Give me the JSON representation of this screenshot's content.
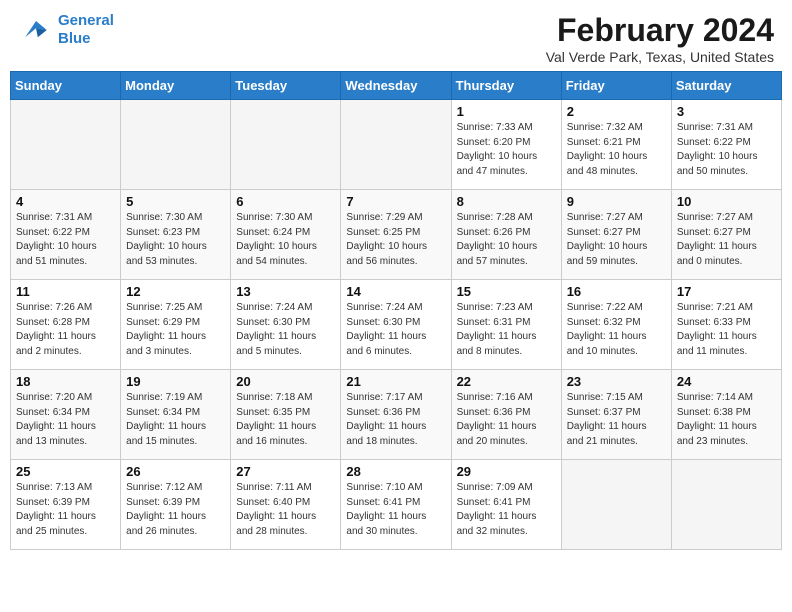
{
  "header": {
    "logo_line1": "General",
    "logo_line2": "Blue",
    "title": "February 2024",
    "subtitle": "Val Verde Park, Texas, United States"
  },
  "days_of_week": [
    "Sunday",
    "Monday",
    "Tuesday",
    "Wednesday",
    "Thursday",
    "Friday",
    "Saturday"
  ],
  "weeks": [
    [
      {
        "day": "",
        "info": ""
      },
      {
        "day": "",
        "info": ""
      },
      {
        "day": "",
        "info": ""
      },
      {
        "day": "",
        "info": ""
      },
      {
        "day": "1",
        "info": "Sunrise: 7:33 AM\nSunset: 6:20 PM\nDaylight: 10 hours\nand 47 minutes."
      },
      {
        "day": "2",
        "info": "Sunrise: 7:32 AM\nSunset: 6:21 PM\nDaylight: 10 hours\nand 48 minutes."
      },
      {
        "day": "3",
        "info": "Sunrise: 7:31 AM\nSunset: 6:22 PM\nDaylight: 10 hours\nand 50 minutes."
      }
    ],
    [
      {
        "day": "4",
        "info": "Sunrise: 7:31 AM\nSunset: 6:22 PM\nDaylight: 10 hours\nand 51 minutes."
      },
      {
        "day": "5",
        "info": "Sunrise: 7:30 AM\nSunset: 6:23 PM\nDaylight: 10 hours\nand 53 minutes."
      },
      {
        "day": "6",
        "info": "Sunrise: 7:30 AM\nSunset: 6:24 PM\nDaylight: 10 hours\nand 54 minutes."
      },
      {
        "day": "7",
        "info": "Sunrise: 7:29 AM\nSunset: 6:25 PM\nDaylight: 10 hours\nand 56 minutes."
      },
      {
        "day": "8",
        "info": "Sunrise: 7:28 AM\nSunset: 6:26 PM\nDaylight: 10 hours\nand 57 minutes."
      },
      {
        "day": "9",
        "info": "Sunrise: 7:27 AM\nSunset: 6:27 PM\nDaylight: 10 hours\nand 59 minutes."
      },
      {
        "day": "10",
        "info": "Sunrise: 7:27 AM\nSunset: 6:27 PM\nDaylight: 11 hours\nand 0 minutes."
      }
    ],
    [
      {
        "day": "11",
        "info": "Sunrise: 7:26 AM\nSunset: 6:28 PM\nDaylight: 11 hours\nand 2 minutes."
      },
      {
        "day": "12",
        "info": "Sunrise: 7:25 AM\nSunset: 6:29 PM\nDaylight: 11 hours\nand 3 minutes."
      },
      {
        "day": "13",
        "info": "Sunrise: 7:24 AM\nSunset: 6:30 PM\nDaylight: 11 hours\nand 5 minutes."
      },
      {
        "day": "14",
        "info": "Sunrise: 7:24 AM\nSunset: 6:30 PM\nDaylight: 11 hours\nand 6 minutes."
      },
      {
        "day": "15",
        "info": "Sunrise: 7:23 AM\nSunset: 6:31 PM\nDaylight: 11 hours\nand 8 minutes."
      },
      {
        "day": "16",
        "info": "Sunrise: 7:22 AM\nSunset: 6:32 PM\nDaylight: 11 hours\nand 10 minutes."
      },
      {
        "day": "17",
        "info": "Sunrise: 7:21 AM\nSunset: 6:33 PM\nDaylight: 11 hours\nand 11 minutes."
      }
    ],
    [
      {
        "day": "18",
        "info": "Sunrise: 7:20 AM\nSunset: 6:34 PM\nDaylight: 11 hours\nand 13 minutes."
      },
      {
        "day": "19",
        "info": "Sunrise: 7:19 AM\nSunset: 6:34 PM\nDaylight: 11 hours\nand 15 minutes."
      },
      {
        "day": "20",
        "info": "Sunrise: 7:18 AM\nSunset: 6:35 PM\nDaylight: 11 hours\nand 16 minutes."
      },
      {
        "day": "21",
        "info": "Sunrise: 7:17 AM\nSunset: 6:36 PM\nDaylight: 11 hours\nand 18 minutes."
      },
      {
        "day": "22",
        "info": "Sunrise: 7:16 AM\nSunset: 6:36 PM\nDaylight: 11 hours\nand 20 minutes."
      },
      {
        "day": "23",
        "info": "Sunrise: 7:15 AM\nSunset: 6:37 PM\nDaylight: 11 hours\nand 21 minutes."
      },
      {
        "day": "24",
        "info": "Sunrise: 7:14 AM\nSunset: 6:38 PM\nDaylight: 11 hours\nand 23 minutes."
      }
    ],
    [
      {
        "day": "25",
        "info": "Sunrise: 7:13 AM\nSunset: 6:39 PM\nDaylight: 11 hours\nand 25 minutes."
      },
      {
        "day": "26",
        "info": "Sunrise: 7:12 AM\nSunset: 6:39 PM\nDaylight: 11 hours\nand 26 minutes."
      },
      {
        "day": "27",
        "info": "Sunrise: 7:11 AM\nSunset: 6:40 PM\nDaylight: 11 hours\nand 28 minutes."
      },
      {
        "day": "28",
        "info": "Sunrise: 7:10 AM\nSunset: 6:41 PM\nDaylight: 11 hours\nand 30 minutes."
      },
      {
        "day": "29",
        "info": "Sunrise: 7:09 AM\nSunset: 6:41 PM\nDaylight: 11 hours\nand 32 minutes."
      },
      {
        "day": "",
        "info": ""
      },
      {
        "day": "",
        "info": ""
      }
    ]
  ]
}
